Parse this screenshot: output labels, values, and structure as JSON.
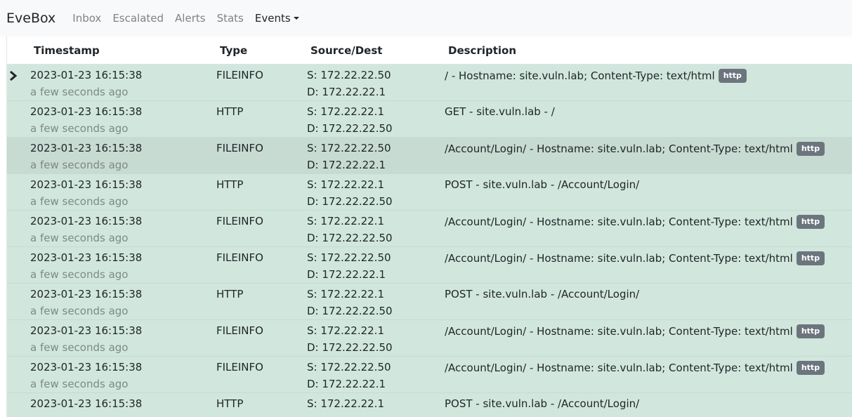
{
  "nav": {
    "brand": "EveBox",
    "links": [
      "Inbox",
      "Escalated",
      "Alerts",
      "Stats"
    ],
    "events_label": "Events"
  },
  "table": {
    "columns": [
      "Timestamp",
      "Type",
      "Source/Dest",
      "Description"
    ],
    "rows": [
      {
        "timestamp": "2023-01-23 16:15:38",
        "ago": "a few seconds ago",
        "type": "FILEINFO",
        "src": "S: 172.22.22.50",
        "dst": "D: 172.22.22.1",
        "desc": "/ - Hostname: site.vuln.lab; Content-Type: text/html",
        "badge": "http"
      },
      {
        "timestamp": "2023-01-23 16:15:38",
        "ago": "a few seconds ago",
        "type": "HTTP",
        "src": "S: 172.22.22.1",
        "dst": "D: 172.22.22.50",
        "desc": "GET - site.vuln.lab - /",
        "badge": ""
      },
      {
        "timestamp": "2023-01-23 16:15:38",
        "ago": "a few seconds ago",
        "type": "FILEINFO",
        "src": "S: 172.22.22.50",
        "dst": "D: 172.22.22.1",
        "desc": "/Account/Login/ - Hostname: site.vuln.lab; Content-Type: text/html",
        "badge": "http"
      },
      {
        "timestamp": "2023-01-23 16:15:38",
        "ago": "a few seconds ago",
        "type": "HTTP",
        "src": "S: 172.22.22.1",
        "dst": "D: 172.22.22.50",
        "desc": "POST - site.vuln.lab - /Account/Login/",
        "badge": ""
      },
      {
        "timestamp": "2023-01-23 16:15:38",
        "ago": "a few seconds ago",
        "type": "FILEINFO",
        "src": "S: 172.22.22.1",
        "dst": "D: 172.22.22.50",
        "desc": "/Account/Login/ - Hostname: site.vuln.lab; Content-Type: text/html",
        "badge": "http"
      },
      {
        "timestamp": "2023-01-23 16:15:38",
        "ago": "a few seconds ago",
        "type": "FILEINFO",
        "src": "S: 172.22.22.50",
        "dst": "D: 172.22.22.1",
        "desc": "/Account/Login/ - Hostname: site.vuln.lab; Content-Type: text/html",
        "badge": "http"
      },
      {
        "timestamp": "2023-01-23 16:15:38",
        "ago": "a few seconds ago",
        "type": "HTTP",
        "src": "S: 172.22.22.1",
        "dst": "D: 172.22.22.50",
        "desc": "POST - site.vuln.lab - /Account/Login/",
        "badge": ""
      },
      {
        "timestamp": "2023-01-23 16:15:38",
        "ago": "a few seconds ago",
        "type": "FILEINFO",
        "src": "S: 172.22.22.1",
        "dst": "D: 172.22.22.50",
        "desc": "/Account/Login/ - Hostname: site.vuln.lab; Content-Type: text/html",
        "badge": "http"
      },
      {
        "timestamp": "2023-01-23 16:15:38",
        "ago": "a few seconds ago",
        "type": "FILEINFO",
        "src": "S: 172.22.22.50",
        "dst": "D: 172.22.22.1",
        "desc": "/Account/Login/ - Hostname: site.vuln.lab; Content-Type: text/html",
        "badge": "http"
      },
      {
        "timestamp": "2023-01-23 16:15:38",
        "ago": "",
        "type": "HTTP",
        "src": "S: 172.22.22.1",
        "dst": "",
        "desc": "POST - site.vuln.lab - /Account/Login/",
        "badge": ""
      }
    ]
  },
  "colors": {
    "row_success": "#d1e7dd",
    "row_hover": "#c7dbd2",
    "badge": "#6c757d"
  },
  "icons": {
    "selected_row_marker": "chevron-right-icon"
  }
}
